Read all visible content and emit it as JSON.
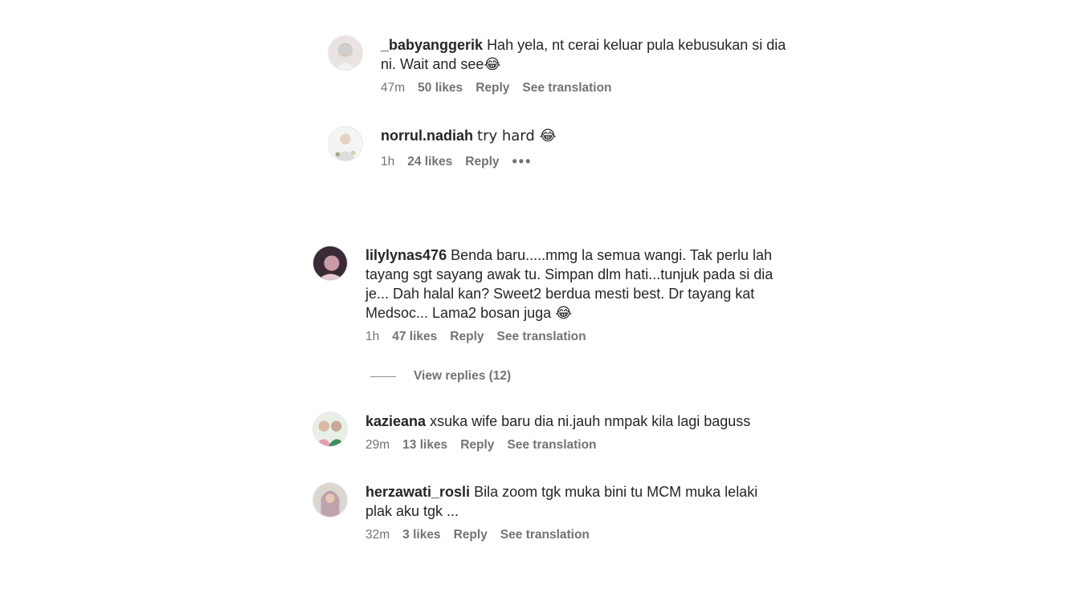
{
  "comments": [
    {
      "username": "_babyanggerik",
      "text": "Hah yela, nt cerai keluar pula kebusukan si dia ni. Wait and see😂",
      "time": "47m",
      "likes": "50 likes",
      "reply": "Reply",
      "translate": "See translation"
    },
    {
      "username": "norrul.nadiah",
      "text": "try hard 😂",
      "time": "1h",
      "likes": "24 likes",
      "reply": "Reply",
      "more": "•••"
    },
    {
      "username": "lilylynas476",
      "text": "Benda baru.....mmg la semua wangi. Tak perlu lah tayang sgt sayang awak tu. Simpan dlm hati...tunjuk pada si dia je... Dah halal kan? Sweet2 berdua mesti best. Dr tayang kat Medsoc... Lama2 bosan juga 😂",
      "time": "1h",
      "likes": "47 likes",
      "reply": "Reply",
      "translate": "See translation"
    },
    {
      "username": "kazieana",
      "text": "xsuka wife baru dia ni.jauh nmpak kila lagi baguss",
      "time": "29m",
      "likes": "13 likes",
      "reply": "Reply",
      "translate": "See translation"
    },
    {
      "username": "herzawati_rosli",
      "text": "Bila zoom tgk muka bini tu MCM muka lelaki plak aku tgk ...",
      "time": "32m",
      "likes": "3 likes",
      "reply": "Reply",
      "translate": "See translation"
    }
  ],
  "view_replies": "View replies (12)"
}
